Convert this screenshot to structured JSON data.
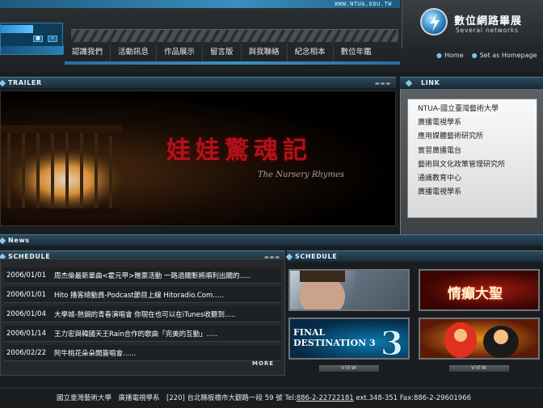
{
  "header": {
    "url": "WWW.NTUA.EDU.TW",
    "logo_title": "數位網路畢展",
    "logo_sub": "Several networks",
    "links": [
      "Home",
      "Set as Homepage"
    ]
  },
  "nav": {
    "items": [
      "認識我們",
      "活動訊息",
      "作品展示",
      "留言版",
      "與我聯絡",
      "紀念相本",
      "數位年鑑"
    ]
  },
  "sections": {
    "trailer": "TRAILER",
    "link": "LINK",
    "news": "News",
    "schedule_left": "SCHEDULE",
    "schedule_right": "SCHEDULE"
  },
  "trailer": {
    "title": "娃娃驚魂記",
    "subtitle": "The Nursery Rhymes"
  },
  "link_list": [
    "NTUA-國立臺灣藝術大學",
    "廣播電視學系",
    "應用媒體藝術研究所",
    "實習廣播電台",
    "藝術與文化政策管理研究所",
    "通識教育中心",
    "廣播電視學系"
  ],
  "schedule": [
    {
      "date": "2006/01/01",
      "text": "周杰倫最新單曲<霍元甲>贈票活動 一路過關斬將順利出關的....."
    },
    {
      "date": "2006/01/01",
      "text": "Hito 播客總動員-Podcast節目上線 Hitoradio.Com....."
    },
    {
      "date": "2006/01/04",
      "text": "大學城-熱鍋的青春演唱會 你現在也可以在iTunes收聽到....."
    },
    {
      "date": "2006/01/14",
      "text": "王力宏與韓國天王Rain合作的歌曲「完美的互動」....."
    },
    {
      "date": "2006/02/22",
      "text": "阿牛桃花朵朵開簽唱會......"
    }
  ],
  "more_label": "MORE",
  "thumbs": [
    {
      "label": ""
    },
    {
      "label": "情癲大聖"
    },
    {
      "label": "FINAL DESTINATION 3"
    },
    {
      "label": ""
    }
  ],
  "view_label": "VIEW",
  "footer": {
    "prefix": "國立臺灣藝術大學　廣播電視學系　[220] 台北縣板橋市大觀路一段 59 號 Tel:",
    "tel": "886-2-22722181",
    "suffix": " ext.348-351 Fax:886-2-29601966"
  },
  "colors": {
    "accent": "#3a8fbf",
    "panel": "#26292c",
    "trailer_red": "#b0121c"
  }
}
